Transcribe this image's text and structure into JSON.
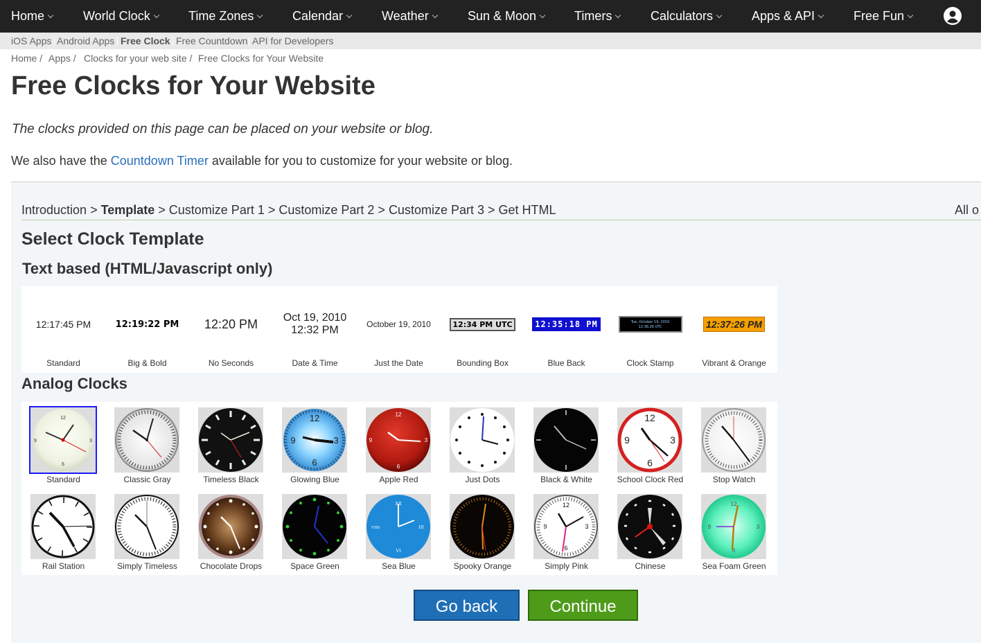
{
  "nav": {
    "items": [
      "Home",
      "World Clock",
      "Time Zones",
      "Calendar",
      "Weather",
      "Sun & Moon",
      "Timers",
      "Calculators",
      "Apps & API",
      "Free Fun"
    ]
  },
  "subnav": {
    "items": [
      "iOS Apps",
      "Android Apps",
      "Free Clock",
      "Free Countdown",
      "API for Developers"
    ],
    "active": "Free Clock"
  },
  "breadcrumb": [
    "Home /",
    "Apps /",
    "Clocks for your web site /",
    "Free Clocks for Your Website"
  ],
  "page": {
    "title": "Free Clocks for Your Website",
    "intro": "The clocks provided on this page can be placed on your website or blog.",
    "also_before": "We also have the ",
    "also_link": "Countdown Timer",
    "also_after": " available for you to customize for your website or blog."
  },
  "wizard": {
    "steps": [
      "Introduction",
      "Template",
      "Customize Part 1",
      "Customize Part 2",
      "Customize Part 3",
      "Get HTML"
    ],
    "separator": " > ",
    "current": "Template",
    "right_text": "All o"
  },
  "section": {
    "title": "Select Clock Template",
    "text_heading": "Text based (HTML/Javascript only)",
    "analog_heading": "Analog Clocks"
  },
  "text_templates": [
    {
      "label": "Standard",
      "sample": "12:17:45 PM"
    },
    {
      "label": "Big & Bold",
      "sample": "12:19:22 PM"
    },
    {
      "label": "No Seconds",
      "sample": "12:20 PM"
    },
    {
      "label": "Date & Time",
      "sample_line1": "Oct 19, 2010",
      "sample_line2": "12:32 PM"
    },
    {
      "label": "Just the Date",
      "sample": "October 19, 2010"
    },
    {
      "label": "Bounding Box",
      "sample": "12:34 PM UTC"
    },
    {
      "label": "Blue Back",
      "sample": "12:35:18 PM"
    },
    {
      "label": "Clock Stamp",
      "sample_line1": "Tue, October 19, 2010",
      "sample_line2": "12:36:26 UTC"
    },
    {
      "label": "Vibrant & Orange",
      "sample": "12:37:26 PM"
    }
  ],
  "analog_templates": [
    {
      "label": "Standard",
      "icon": "standard-clock-icon",
      "selected": true
    },
    {
      "label": "Classic Gray",
      "icon": "classic-gray-clock-icon"
    },
    {
      "label": "Timeless Black",
      "icon": "timeless-black-clock-icon"
    },
    {
      "label": "Glowing Blue",
      "icon": "glowing-blue-clock-icon"
    },
    {
      "label": "Apple Red",
      "icon": "apple-red-clock-icon"
    },
    {
      "label": "Just Dots",
      "icon": "just-dots-clock-icon"
    },
    {
      "label": "Black & White",
      "icon": "black-white-clock-icon"
    },
    {
      "label": "School Clock Red",
      "icon": "school-clock-red-icon"
    },
    {
      "label": "Stop Watch",
      "icon": "stop-watch-clock-icon"
    },
    {
      "label": "Rail Station",
      "icon": "rail-station-clock-icon"
    },
    {
      "label": "Simply Timeless",
      "icon": "simply-timeless-clock-icon"
    },
    {
      "label": "Chocolate Drops",
      "icon": "chocolate-drops-clock-icon"
    },
    {
      "label": "Space Green",
      "icon": "space-green-clock-icon"
    },
    {
      "label": "Sea Blue",
      "icon": "sea-blue-clock-icon"
    },
    {
      "label": "Spooky Orange",
      "icon": "spooky-orange-clock-icon"
    },
    {
      "label": "Simply Pink",
      "icon": "simply-pink-clock-icon"
    },
    {
      "label": "Chinese",
      "icon": "chinese-clock-icon"
    },
    {
      "label": "Sea Foam Green",
      "icon": "sea-foam-green-clock-icon"
    }
  ],
  "clock_faces": {
    "12": "12",
    "3": "3",
    "6": "6",
    "9": "9",
    "roman_12": "XII",
    "roman_3": "III",
    "roman_6": "VI",
    "roman_9": "VIIII"
  },
  "buttons": {
    "back": "Go back",
    "continue": "Continue"
  },
  "colors": {
    "nav_bg": "#222222",
    "link": "#2a6ebb",
    "back_btn": "#1f6fb7",
    "continue_btn": "#4e9b1a",
    "selected_outline": "#1a1aff"
  }
}
